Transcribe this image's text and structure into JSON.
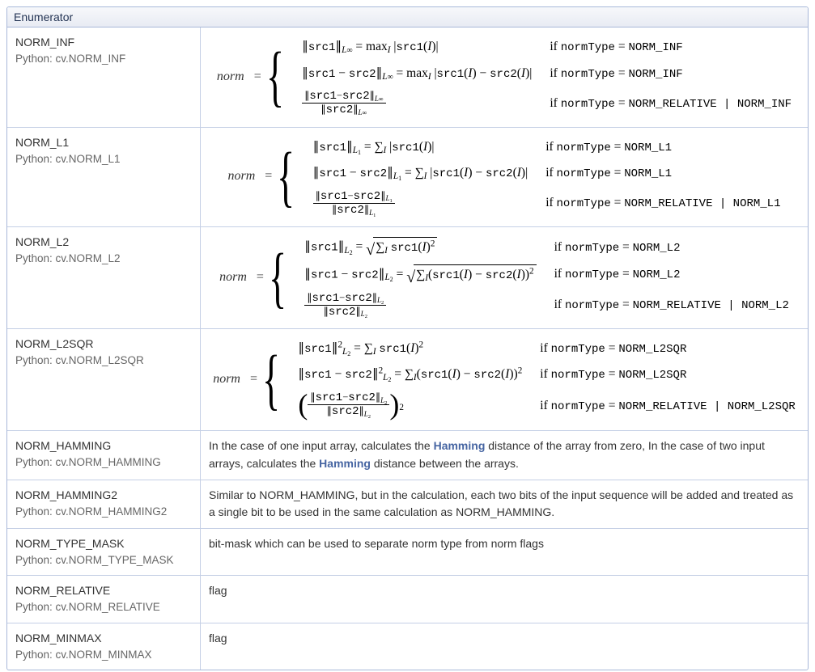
{
  "header": "Enumerator",
  "rows": [
    {
      "name": "NORM_INF",
      "py": "Python: cv.NORM_INF",
      "math": {
        "sub": "L<sub>&infin;</sub>",
        "case1_lhs": "&#8741;<span class='tt'>src1</span>&#8741;<sub><i>L</i><span class='inf'>&infin;</span></sub> = max<sub><i>I</i></sub> |<span class='tt'>src1</span>(<i>I</i>)|",
        "case2_lhs": "&#8741;<span class='tt'>src1</span> &minus; <span class='tt'>src2</span>&#8741;<sub><i>L</i><span class='inf'>&infin;</span></sub> = max<sub><i>I</i></sub> |<span class='tt'>src1</span>(<i>I</i>) &minus; <span class='tt'>src2</span>(<i>I</i>)|",
        "frac_num": "&#8741;<span class='tt'>src1</span>&minus;<span class='tt'>src2</span>&#8741;<sub><i>L</i><span class='inf'>&infin;</span></sub>",
        "frac_den": "&#8741;<span class='tt'>src2</span>&#8741;<sub><i>L</i><span class='inf'>&infin;</span></sub>",
        "cond1": "if <span class='tt'>normType</span> = <span class='tt'>NORM_INF</span>",
        "cond2": "if <span class='tt'>normType</span> = <span class='tt'>NORM_INF</span>",
        "cond3": "if <span class='tt'>normType</span> = <span class='tt'>NORM_RELATIVE | NORM_INF</span>"
      }
    },
    {
      "name": "NORM_L1",
      "py": "Python: cv.NORM_L1",
      "math": {
        "case1_lhs": "&#8741;<span class='tt'>src1</span>&#8741;<sub><i>L</i><sub>1</sub></sub> = &sum;<sub><i>I</i></sub> |<span class='tt'>src1</span>(<i>I</i>)|",
        "case2_lhs": "&#8741;<span class='tt'>src1</span> &minus; <span class='tt'>src2</span>&#8741;<sub><i>L</i><sub>1</sub></sub> = &sum;<sub><i>I</i></sub> |<span class='tt'>src1</span>(<i>I</i>) &minus; <span class='tt'>src2</span>(<i>I</i>)|",
        "frac_num": "&#8741;<span class='tt'>src1</span>&minus;<span class='tt'>src2</span>&#8741;<sub><i>L</i><sub>1</sub></sub>",
        "frac_den": "&#8741;<span class='tt'>src2</span>&#8741;<sub><i>L</i><sub>1</sub></sub>",
        "cond1": "if <span class='tt'>normType</span> = <span class='tt'>NORM_L1</span>",
        "cond2": "if <span class='tt'>normType</span> = <span class='tt'>NORM_L1</span>",
        "cond3": "if <span class='tt'>normType</span> = <span class='tt'>NORM_RELATIVE | NORM_L1</span>"
      }
    },
    {
      "name": "NORM_L2",
      "py": "Python: cv.NORM_L2",
      "math": {
        "case1_lhs": "&#8741;<span class='tt'>src1</span>&#8741;<sub><i>L</i><sub>2</sub></sub> = <span class='sqrt'><span class='surd'>&radic;</span><span class='radicand'>&sum;<sub><i>I</i></sub> <span class='tt'>src1</span>(<i>I</i>)<sup>2</sup></span></span>",
        "case2_lhs": "&#8741;<span class='tt'>src1</span> &minus; <span class='tt'>src2</span>&#8741;<sub><i>L</i><sub>2</sub></sub> = <span class='sqrt'><span class='surd'>&radic;</span><span class='radicand'>&sum;<sub><i>I</i></sub>(<span class='tt'>src1</span>(<i>I</i>) &minus; <span class='tt'>src2</span>(<i>I</i>))<sup>2</sup></span></span>",
        "frac_num": "&#8741;<span class='tt'>src1</span>&minus;<span class='tt'>src2</span>&#8741;<sub><i>L</i><sub>2</sub></sub>",
        "frac_den": "&#8741;<span class='tt'>src2</span>&#8741;<sub><i>L</i><sub>2</sub></sub>",
        "cond1": "if <span class='tt'>normType</span> = <span class='tt'>NORM_L2</span>",
        "cond2": "if <span class='tt'>normType</span> = <span class='tt'>NORM_L2</span>",
        "cond3": "if <span class='tt'>normType</span> = <span class='tt'>NORM_RELATIVE | NORM_L2</span>"
      }
    },
    {
      "name": "NORM_L2SQR",
      "py": "Python: cv.NORM_L2SQR",
      "math": {
        "case1_lhs": "&#8741;<span class='tt'>src1</span>&#8741;<sup>2</sup><sub><i>L</i><sub>2</sub></sub> = &sum;<sub><i>I</i></sub> <span class='tt'>src1</span>(<i>I</i>)<sup>2</sup>",
        "case2_lhs": "&#8741;<span class='tt'>src1</span> &minus; <span class='tt'>src2</span>&#8741;<sup>2</sup><sub><i>L</i><sub>2</sub></sub> = &sum;<sub><i>I</i></sub>(<span class='tt'>src1</span>(<i>I</i>) &minus; <span class='tt'>src2</span>(<i>I</i>))<sup>2</sup>",
        "frac_num": "&#8741;<span class='tt'>src1</span>&minus;<span class='tt'>src2</span>&#8741;<sub><i>L</i><sub>2</sub></sub>",
        "frac_den": "&#8741;<span class='tt'>src2</span>&#8741;<sub><i>L</i><sub>2</sub></sub>",
        "squared_frac": true,
        "cond1": "if <span class='tt'>normType</span> = <span class='tt'>NORM_L2SQR</span>",
        "cond2": "if <span class='tt'>normType</span> = <span class='tt'>NORM_L2SQR</span>",
        "cond3": "if <span class='tt'>normType</span> = <span class='tt'>NORM_RELATIVE | NORM_L2SQR</span>"
      }
    },
    {
      "name": "NORM_HAMMING",
      "py": "Python: cv.NORM_HAMMING",
      "desc_html": "In the case of one input array, calculates the <a class='hamming' href='#'>Hamming</a> distance of the array from zero, In the case of two input arrays, calculates the <a class='hamming' href='#'>Hamming</a> distance between the arrays."
    },
    {
      "name": "NORM_HAMMING2",
      "py": "Python: cv.NORM_HAMMING2",
      "desc_html": "Similar to NORM_HAMMING, but in the calculation, each two bits of the input sequence will be added and treated as a single bit to be used in the same calculation as NORM_HAMMING."
    },
    {
      "name": "NORM_TYPE_MASK",
      "py": "Python: cv.NORM_TYPE_MASK",
      "desc_html": "bit-mask which can be used to separate norm type from norm flags"
    },
    {
      "name": "NORM_RELATIVE",
      "py": "Python: cv.NORM_RELATIVE",
      "desc_html": "flag"
    },
    {
      "name": "NORM_MINMAX",
      "py": "Python: cv.NORM_MINMAX",
      "desc_html": "flag"
    }
  ],
  "norm_label": "norm",
  "equals": "="
}
